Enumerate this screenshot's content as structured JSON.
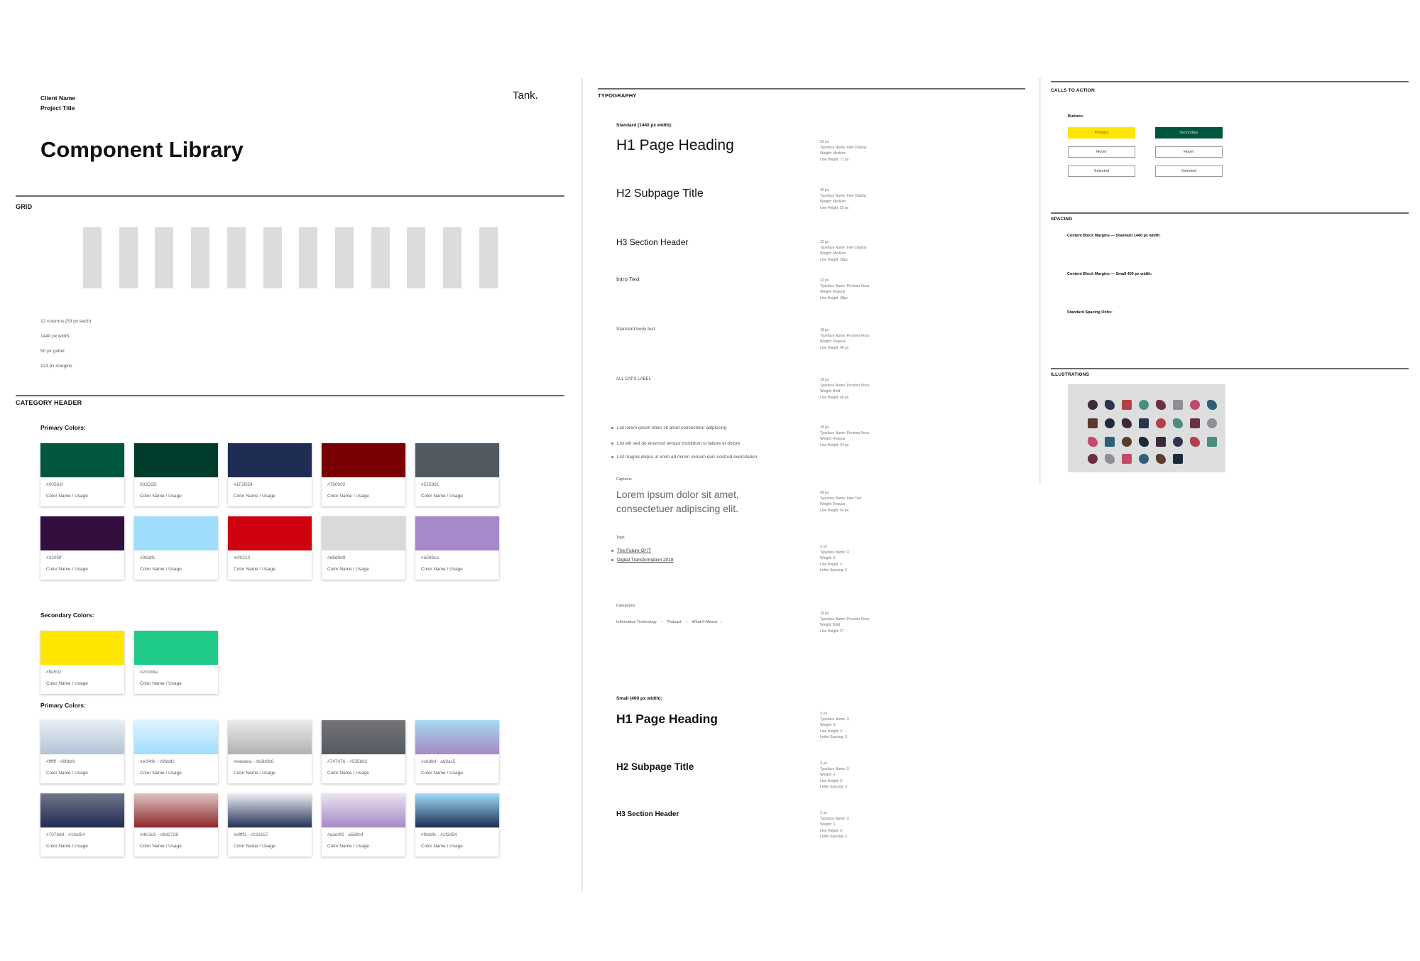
{
  "header": {
    "client_name": "Client Name",
    "project_title": "Project Title",
    "brand": "Tank.",
    "title": "Component Library"
  },
  "grid": {
    "section": "GRID",
    "spec": [
      "12 columns (53 px each)",
      "1440 px width",
      "50 px gutter",
      "123 px margins"
    ]
  },
  "colors": {
    "section": "CATEGORY HEADER",
    "primary_label": "Primary Colors:",
    "primary": [
      {
        "hex": "#00563f",
        "color": "#00563f",
        "usage": "Color Name / Usage"
      },
      {
        "hex": "003D2D",
        "color": "#003d2d",
        "usage": "Color Name / Usage"
      },
      {
        "hex": "#1F2D54",
        "color": "#1f2d54",
        "usage": "Color Name / Usage"
      },
      {
        "hex": "#790002",
        "color": "#790002",
        "usage": "Color Name / Usage"
      },
      {
        "hex": "#515961",
        "color": "#515961",
        "usage": "Color Name / Usage"
      },
      {
        "hex": "#320f3f",
        "color": "#320f3f",
        "usage": "Color Name / Usage"
      },
      {
        "hex": "#9fddfc",
        "color": "#9fddfc",
        "usage": "Color Name / Usage"
      },
      {
        "hex": "#cf0210",
        "color": "#cf0210",
        "usage": "Color Name / Usage"
      },
      {
        "hex": "#d9d9d9",
        "color": "#d9d9d9",
        "usage": "Color Name / Usage"
      },
      {
        "hex": "#a589ca",
        "color": "#a589ca",
        "usage": "Color Name / Usage"
      }
    ],
    "secondary_label": "Secondary Colors:",
    "secondary": [
      {
        "hex": "#ffe502",
        "color": "#ffe502",
        "usage": "Color Name / Usage"
      },
      {
        "hex": "#20cb8a",
        "color": "#20cb8a",
        "usage": "Color Name / Usage"
      }
    ],
    "gradient_label": "Primary Colors:",
    "gradients": [
      {
        "hex": "#ffffff - #9fddfc",
        "from": "#e9eef5",
        "to": "#b3c3d6",
        "usage": "Color Name / Usage"
      },
      {
        "hex": "#e0f4fe - #9fddfc",
        "from": "#e0f4fe",
        "to": "#9fddfc",
        "usage": "Color Name / Usage"
      },
      {
        "hex": "#eaeaea - #b3b0b0",
        "from": "#eaeaea",
        "to": "#b3b0b0",
        "usage": "Color Name / Usage"
      },
      {
        "hex": "#747476 - #535b62",
        "from": "#747476",
        "to": "#535b62",
        "usage": "Color Name / Usage"
      },
      {
        "hex": "#c6dfef - a68ac5",
        "from": "#a6d9f2",
        "to": "#a68ac5",
        "usage": "Color Name / Usage"
      },
      {
        "hex": "#707689 - #1fed54",
        "from": "#707689",
        "to": "#1f2d54",
        "usage": "Color Name / Usage"
      },
      {
        "hex": "#dfc3c5 - #8d2728",
        "from": "#dfc3c5",
        "to": "#8d2728",
        "usage": "Color Name / Usage"
      },
      {
        "hex": "#effff3 - #233157",
        "from": "#eef1f3",
        "to": "#233157",
        "usage": "Color Name / Usage"
      },
      {
        "hex": "#aae4f2 - a589c4",
        "from": "#ece4f2",
        "to": "#a589c4",
        "usage": "Color Name / Usage"
      },
      {
        "hex": "#9fddfc - #1f2d54",
        "from": "#9fddfc",
        "to": "#1f2d54",
        "usage": "Color Name / Usage"
      }
    ]
  },
  "typography": {
    "section": "TYPOGRAPHY",
    "standard_label": "Standard (1440 px width):",
    "h1": "H1 Page Heading",
    "h1_spec": "52 px\nTypeface Name: Inter Display\nWeight: Medium\nLine Height: 71 px",
    "h2": "H2 Subpage Title",
    "h2_spec": "40 px\nTypeface Name: Inter Display\nWeight: Medium\nLine Height: 52 px",
    "h3": "H3 Section Header",
    "h3_spec": "32 px\nTypeface Name: Inter Display\nWeight: Medium\nLine Height: 38px",
    "intro": "Intro Text",
    "intro_spec": "22 px\nTypeface Name: Proxima Nova\nWeight: Regular\nLine Height: 38px",
    "body": "Standard body text",
    "body_spec": "18 px\nTypeface Name: Proxima Nova\nWeight: Regular\nLine Height: 46 px",
    "caps": "ALL CAPS LABEL",
    "caps_spec": "18 px\nTypeface Name: Proxima Nova\nWeight: Bold\nLine Height: 46 px",
    "list": [
      "List lorem ipsum dolor sit amet consectetur adipiscing",
      "List elit sed do eiusmod tempor incididunt ut labore et dolore",
      "List magna aliqua ut enim ad minim veniam quis nostrud exercitation"
    ],
    "list_spec": "18 px\nTypeface Name: Proxima Nova\nWeight: Regular\nLine Height: 24 px",
    "captions_label": "Captions",
    "caption": "Lorem ipsum dolor sit amet,\nconsectetuer adipiscing elit.",
    "caption_spec": "48 px\nTypeface Name: Inter Text\nWeight: Regular\nLine Height: 54 px",
    "tags_label": "Tags",
    "tags": [
      "The Future Of IT",
      "Digital Transformation 2018"
    ],
    "tags_spec": "X px\nTypeface Name: X\nWeight: X\nLine Height: X\nLetter Spacing: X",
    "categories_label": "Categories",
    "categories": [
      "Information Technology",
      "Podcast",
      "What-It-Means"
    ],
    "categories_spec": "18 px\nTypeface Name: Proxima Nova\nWeight: Bold\nLine Height: 27",
    "small_label": "Small (400 px width):",
    "s_h1": "H1 Page Heading",
    "s_h2": "H2 Subpage Title",
    "s_h3": "H3 Section Header",
    "small_spec": "X px\nTypeface Name: X\nWeight: X\nLine Height: X\nLetter Spacing: X"
  },
  "cta": {
    "section": "CALLS TO ACTION",
    "buttons_label": "Buttons:",
    "primary": "Primary",
    "secondary": "Secondary",
    "hover": "Hover",
    "selected": "Selected",
    "primary_color": "#ffe502",
    "secondary_color": "#00563f"
  },
  "spacing": {
    "section": "SPACING",
    "items": [
      "Content Block Margins — Standard 1440 px width:",
      "Content Block Margins — Small 400 px width:",
      "Standard Spacing Units:"
    ]
  },
  "illustrations": {
    "section": "ILLUSTRATIONS"
  }
}
